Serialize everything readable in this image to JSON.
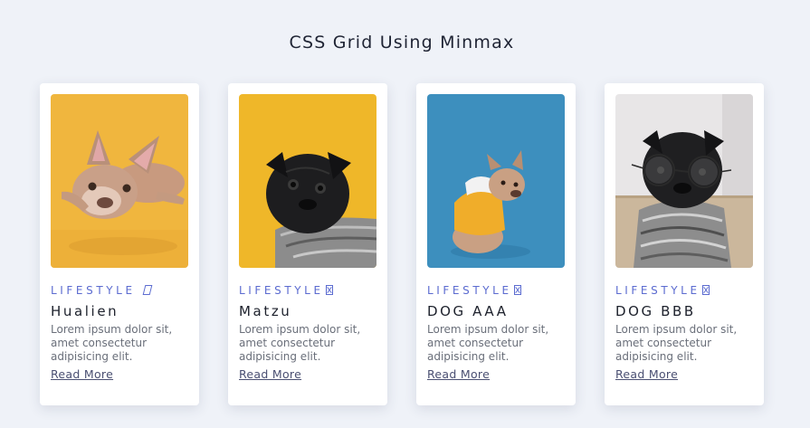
{
  "page": {
    "title": "CSS Grid Using Minmax"
  },
  "cards": [
    {
      "category": "LIFESTYLE",
      "category_icon": "slanted-box-glyph-icon",
      "name": "Hualien",
      "description": "Lorem ipsum dolor sit, amet consectetur adipisicing elit.",
      "link": "Read More",
      "photo": "french-bulldog-on-yellow-background"
    },
    {
      "category": "LIFESTYLE",
      "category_icon": "crossed-box-glyph-icon",
      "name": "Matzu",
      "description": "Lorem ipsum dolor sit, amet consectetur adipisicing elit.",
      "link": "Read More",
      "photo": "black-pug-on-yellow-background"
    },
    {
      "category": "LIFESTYLE",
      "category_icon": "crossed-box-glyph-icon",
      "name": "DOG AAA",
      "description": "Lorem ipsum dolor sit, amet consectetur adipisicing elit.",
      "link": "Read More",
      "photo": "french-bulldog-in-hoodie-on-blue-background"
    },
    {
      "category": "LIFESTYLE",
      "category_icon": "crossed-box-glyph-icon",
      "name": "DOG BBB",
      "description": "Lorem ipsum dolor sit, amet consectetur adipisicing elit.",
      "link": "Read More",
      "photo": "pug-with-glasses-on-white-background"
    }
  ],
  "colors": {
    "background": "#eff2f8",
    "accent": "#5b6bd0",
    "card": "#ffffff"
  }
}
